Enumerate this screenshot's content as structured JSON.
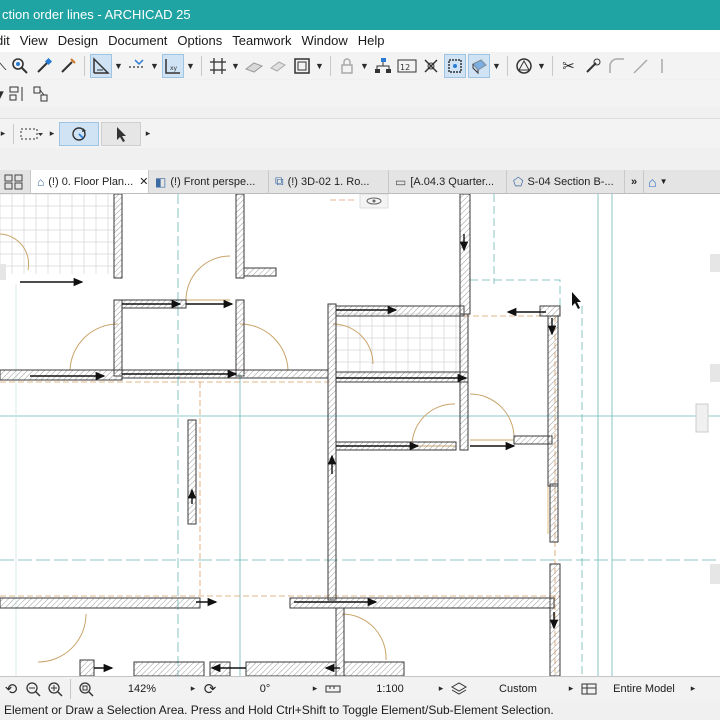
{
  "window": {
    "title": "ction order lines - ARCHICAD 25"
  },
  "menu": [
    "dit",
    "View",
    "Design",
    "Document",
    "Options",
    "Teamwork",
    "Window",
    "Help"
  ],
  "tabs": [
    {
      "label": "(!) 0. Floor Plan...",
      "icon": "floor-plan-icon",
      "active": true,
      "closable": true
    },
    {
      "label": "(!) Front perspe...",
      "icon": "perspective-icon",
      "active": false
    },
    {
      "label": "(!) 3D-02 1. Ro...",
      "icon": "3d-view-icon",
      "active": false
    },
    {
      "label": "[A.04.3 Quarter...",
      "icon": "layout-icon",
      "active": false
    },
    {
      "label": "S-04 Section B-...",
      "icon": "section-icon",
      "active": false
    }
  ],
  "status": {
    "zoom": "142%",
    "angle": "0°",
    "scale": "1:100",
    "pen_set": "Custom",
    "model_view": "Entire Model"
  },
  "hint": "Element or Draw a Selection Area. Press and Hold Ctrl+Shift to Toggle Element/Sub-Element Selection.",
  "colors": {
    "titlebar": "#1fa3a3",
    "wall_hatch": "#8a8a8a",
    "door": "#c8a060",
    "guide": "#5fb0b0"
  }
}
